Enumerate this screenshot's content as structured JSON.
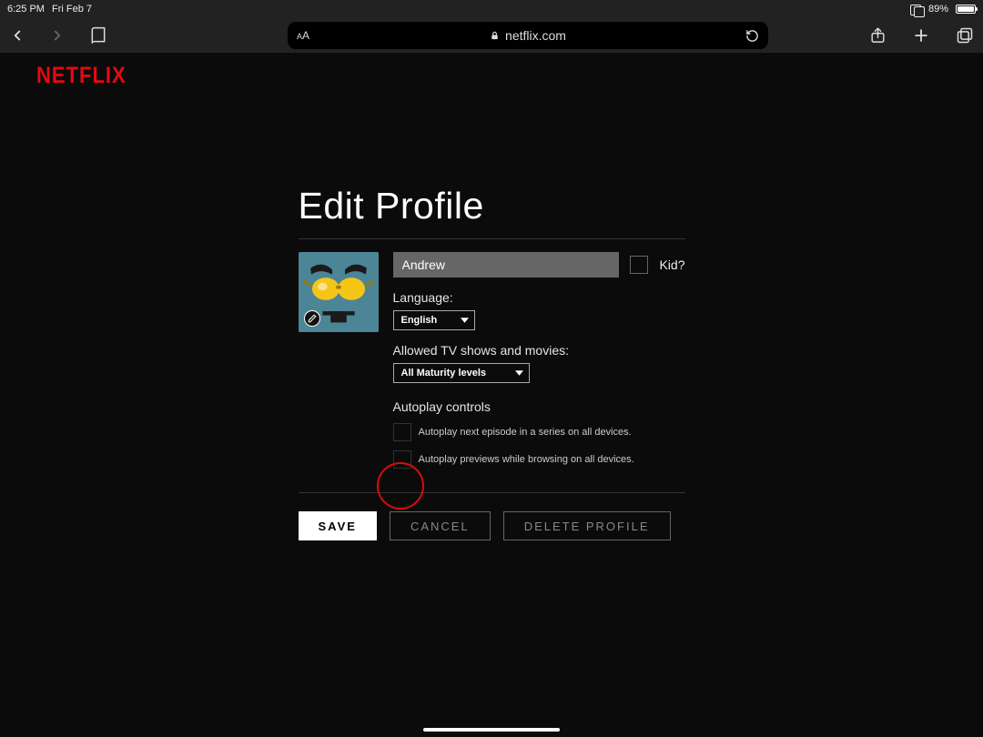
{
  "status": {
    "time": "6:25 PM",
    "date": "Fri Feb 7",
    "battery_pct": "89%"
  },
  "browser": {
    "url_host": "netflix.com",
    "text_size_label": "A"
  },
  "brand": {
    "logo_text": "NETFLIX"
  },
  "page": {
    "title": "Edit Profile",
    "name_value": "Andrew",
    "kid_label": "Kid?",
    "language_label": "Language:",
    "language_value": "English",
    "maturity_label": "Allowed TV shows and movies:",
    "maturity_value": "All Maturity levels",
    "autoplay_title": "Autoplay controls",
    "autoplay_next": "Autoplay next episode in a series on all devices.",
    "autoplay_previews": "Autoplay previews while browsing on all devices.",
    "save": "SAVE",
    "cancel": "CANCEL",
    "delete": "DELETE PROFILE"
  }
}
